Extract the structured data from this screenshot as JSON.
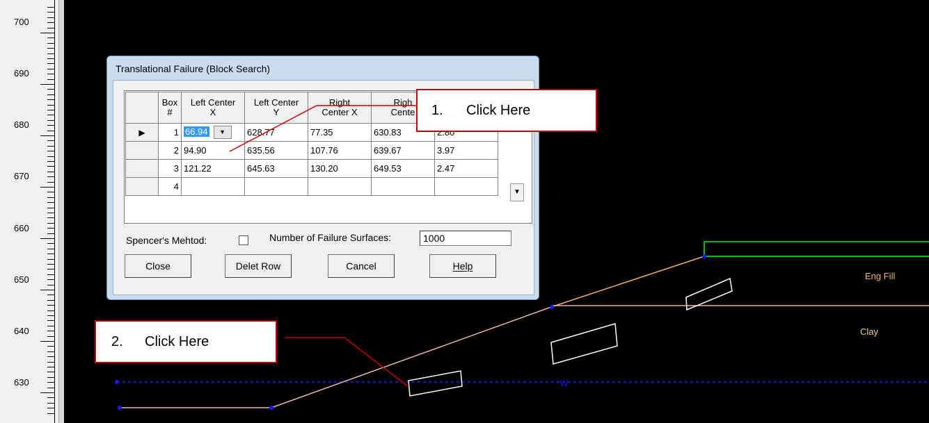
{
  "ruler": {
    "labels": [
      "700",
      "690",
      "680",
      "670",
      "660",
      "650",
      "640",
      "630"
    ]
  },
  "dialog": {
    "title": "Translational Failure (Block Search)",
    "columns": [
      {
        "line1": "Box",
        "line2": "#"
      },
      {
        "line1": "Left Center",
        "line2": "X"
      },
      {
        "line1": "Left Center",
        "line2": "Y"
      },
      {
        "line1": "Right",
        "line2": "Center X"
      },
      {
        "line1": "Righ",
        "line2": "Cente"
      }
    ],
    "rows": [
      {
        "box": "1",
        "lx": "66.94",
        "ly": "628.77",
        "rx": "77.35",
        "ry": "630.83",
        "w": "2.80"
      },
      {
        "box": "2",
        "lx": "94.90",
        "ly": "635.56",
        "rx": "107.76",
        "ry": "639.67",
        "w": "3.97"
      },
      {
        "box": "3",
        "lx": "121.22",
        "ly": "645.63",
        "rx": "130.20",
        "ry": "649.53",
        "w": "2.47"
      },
      {
        "box": "4",
        "lx": "",
        "ly": "",
        "rx": "",
        "ry": "",
        "w": ""
      }
    ],
    "current_row_marker": "▶",
    "dropdown_glyph": "▼",
    "scroll_down_glyph": "▼",
    "spencer_label": "Spencer's Mehtod:",
    "surfaces_label": "Number of Failure Surfaces:",
    "surfaces_value": "1000",
    "buttons": {
      "close": "Close",
      "delete_row": "Delet Row",
      "cancel": "Cancel",
      "help": "Help"
    }
  },
  "callouts": {
    "one": {
      "number": "1.",
      "text": "Click Here"
    },
    "two": {
      "number": "2.",
      "text": "Click Here"
    }
  },
  "drawing": {
    "materials": [
      {
        "name": "Eng Fill",
        "color": "#f4b56a"
      },
      {
        "name": "Clay",
        "color": "#f4c8a0"
      }
    ],
    "water_marker": "W",
    "colors": {
      "ground": "#e8b8a8",
      "fill_surface": "#f4b56a",
      "water": "#1a1aff",
      "boundary": "#00c000",
      "callout": "#c00000"
    }
  }
}
